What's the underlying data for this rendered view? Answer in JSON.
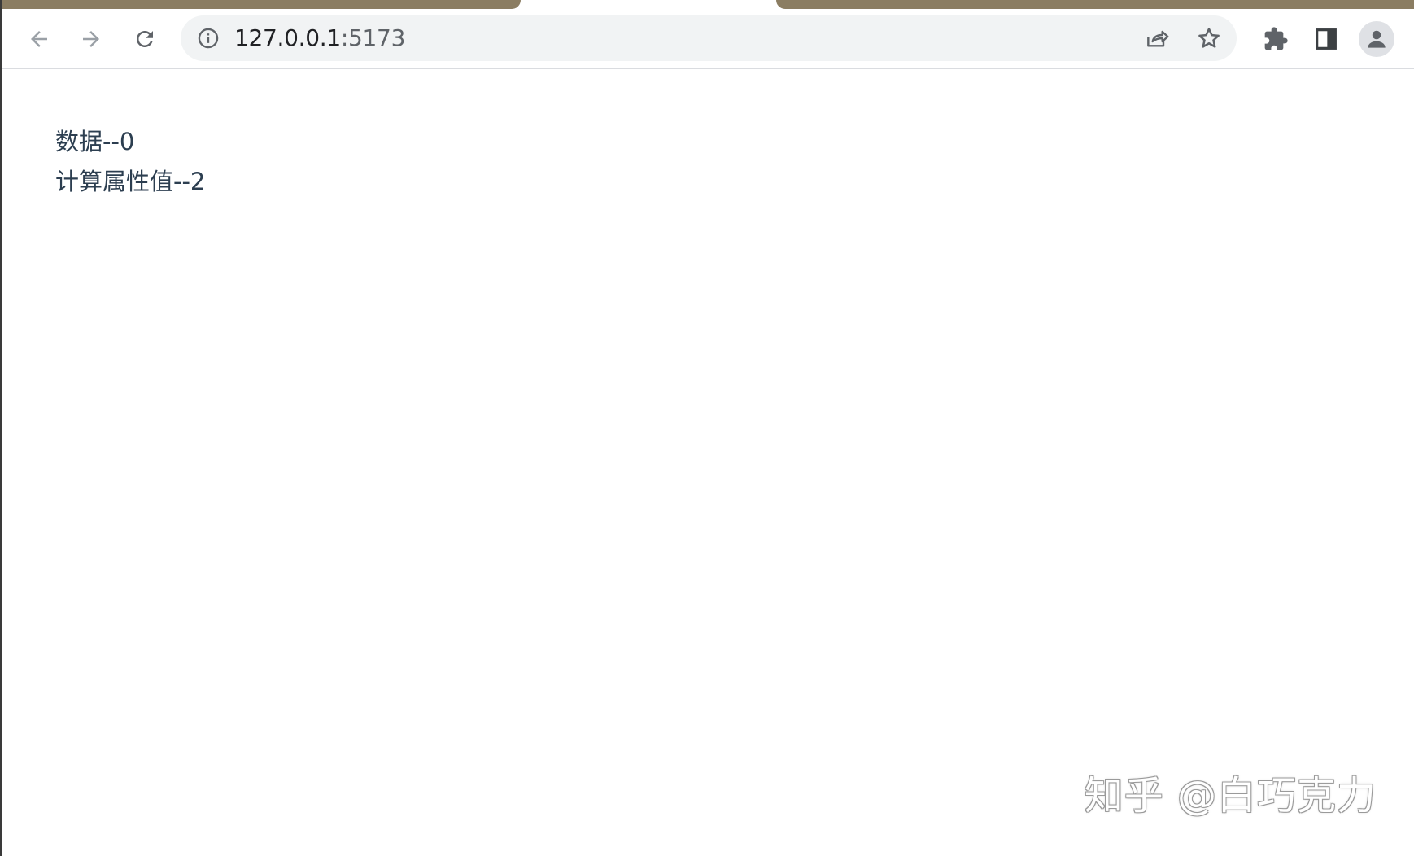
{
  "browser": {
    "url_host": "127.0.0.1",
    "url_port": ":5173",
    "tab_accent_color": "#8b7d62",
    "icons": {
      "back": "arrow-left-icon",
      "forward": "arrow-right-icon",
      "reload": "reload-icon",
      "site_info": "info-icon",
      "share": "share-icon",
      "bookmark": "star-icon",
      "extensions": "puzzle-icon",
      "side_panel": "side-panel-icon",
      "profile": "person-icon"
    }
  },
  "page": {
    "lines": [
      {
        "text": "数据--0"
      },
      {
        "text": "计算属性值--2"
      }
    ],
    "text_color": "#2c3e50"
  },
  "watermark": {
    "text": "知乎 @白巧克力"
  }
}
